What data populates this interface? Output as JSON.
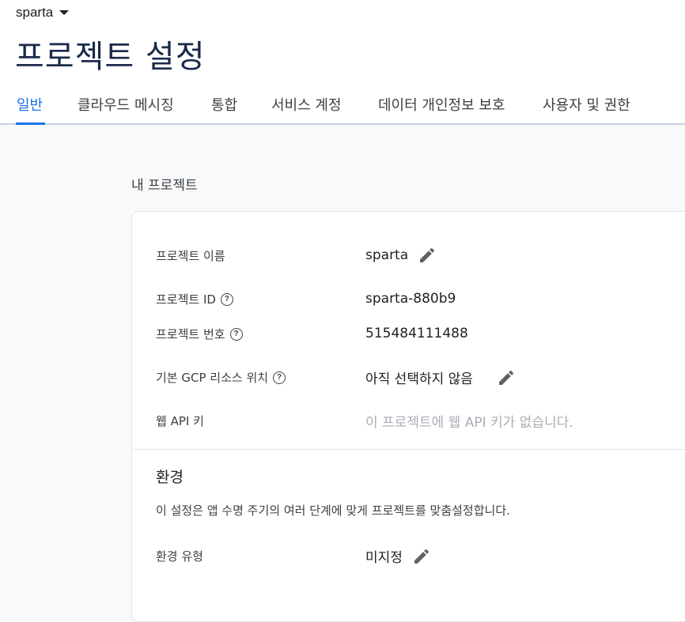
{
  "header": {
    "project_name": "sparta",
    "page_title": "프로젝트 설정"
  },
  "tabs": [
    {
      "label": "일반",
      "active": true
    },
    {
      "label": "클라우드 메시징",
      "active": false
    },
    {
      "label": "통합",
      "active": false
    },
    {
      "label": "서비스 계정",
      "active": false
    },
    {
      "label": "데이터 개인정보 보호",
      "active": false
    },
    {
      "label": "사용자 및 권한",
      "active": false
    }
  ],
  "my_project": {
    "section_label": "내 프로젝트",
    "rows": [
      {
        "label": "프로젝트 이름",
        "value": "sparta",
        "has_help": false,
        "editable": true
      },
      {
        "label": "프로젝트 ID",
        "value": "sparta-880b9",
        "has_help": true,
        "editable": false
      },
      {
        "label": "프로젝트 번호",
        "value": "515484111488",
        "has_help": true,
        "editable": false
      },
      {
        "label": "기본 GCP 리소스 위치",
        "value": "아직 선택하지 않음",
        "has_help": true,
        "editable": true
      },
      {
        "label": "웹 API 키",
        "value": "이 프로젝트에 웹 API 키가 없습니다.",
        "has_help": false,
        "editable": false
      }
    ]
  },
  "environment": {
    "heading": "환경",
    "description": "이 설정은 앱 수명 주기의 여러 단계에 맞게 프로젝트를 맞춤설정합니다.",
    "type_label": "환경 유형",
    "type_value": "미지정"
  },
  "icons": {
    "help": "?",
    "edit": "pencil-icon",
    "dropdown": "caret-down-icon"
  },
  "colors": {
    "accent": "#1a73e8",
    "title": "#1a2a4a",
    "edit_icon": "#5f6368",
    "muted_text": "#a9aeb5"
  }
}
